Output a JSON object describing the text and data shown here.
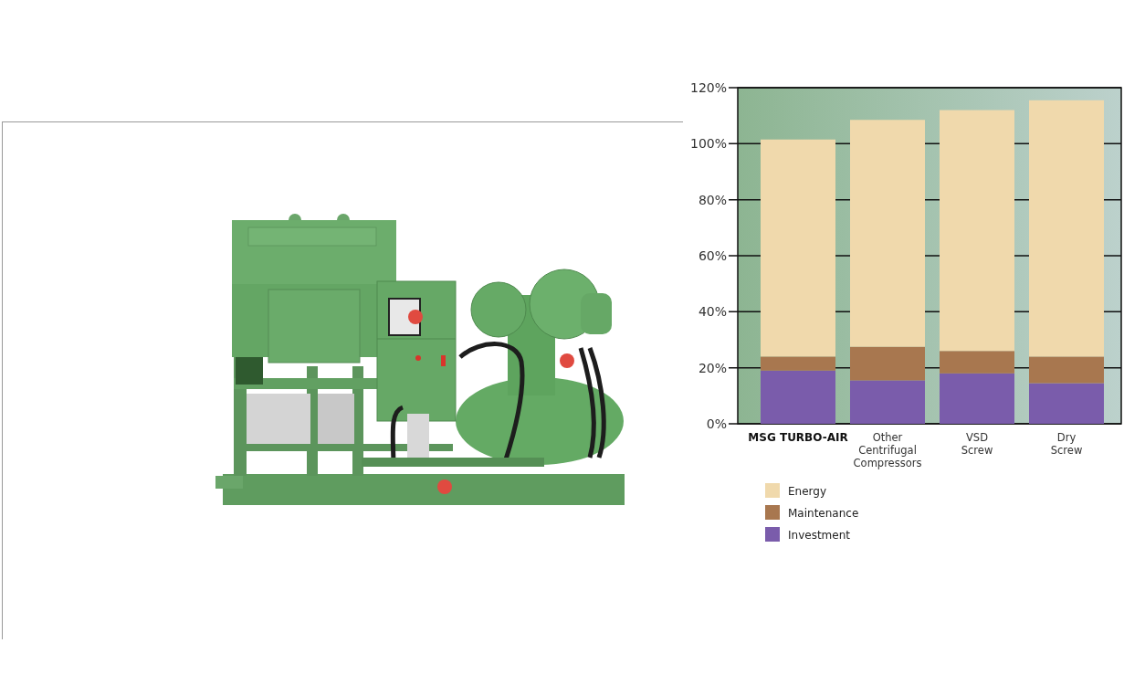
{
  "chart_data": {
    "type": "bar",
    "stacked": true,
    "grid": true,
    "legend": true,
    "orientation": "vertical",
    "categories": [
      "MSG TURBO-AIR",
      "Other Centrifugal Compressors",
      "VSD Screw",
      "Dry Screw"
    ],
    "series": [
      {
        "name": "Investment",
        "color": "#7a5cab",
        "values": [
          19,
          15.5,
          18,
          14.5
        ]
      },
      {
        "name": "Maintenance",
        "color": "#a8774f",
        "values": [
          5,
          12,
          8,
          9.5
        ]
      },
      {
        "name": "Energy",
        "color": "#f0d9ac",
        "values": [
          77.5,
          81,
          86,
          91.5
        ]
      }
    ],
    "ylim": [
      0,
      120
    ],
    "yticks": [
      {
        "value": 0,
        "label": "0%"
      },
      {
        "value": 20,
        "label": "20%"
      },
      {
        "value": 40,
        "label": "40%"
      },
      {
        "value": 60,
        "label": "60%"
      },
      {
        "value": 80,
        "label": "80%"
      },
      {
        "value": 100,
        "label": "100%"
      },
      {
        "value": 120,
        "label": "120%"
      }
    ]
  }
}
